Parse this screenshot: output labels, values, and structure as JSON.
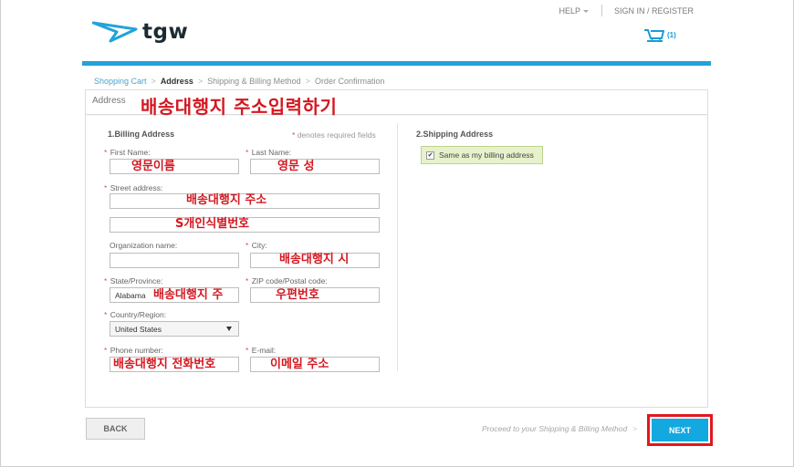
{
  "header": {
    "logo_text": "tgw",
    "help_label": "HELP",
    "signin_label": "SIGN IN / REGISTER",
    "cart_count": "(1)",
    "accent_color": "#22a3d9"
  },
  "breadcrumb": {
    "steps": [
      "Shopping Cart",
      "Address",
      "Shipping & Billing Method",
      "Order Confirmation"
    ],
    "separator": ">"
  },
  "panel": {
    "title": "Address",
    "annotation": "배송대행지 주소입력하기"
  },
  "billing": {
    "title": "1.Billing Address",
    "required_note": "denotes required fields",
    "required_star": "*",
    "first_name": {
      "label": "First Name:",
      "annotation": "영문이름"
    },
    "last_name": {
      "label": "Last Name:",
      "annotation": "영문 성"
    },
    "street": {
      "label": "Street address:",
      "annotation_line1": "배송대행지 주소",
      "annotation_line2": "S개인식별번호"
    },
    "organization": {
      "label": "Organization name:"
    },
    "city": {
      "label": "City:",
      "annotation": "배송대행지 시"
    },
    "state": {
      "label": "State/Province:",
      "value": "Alabama",
      "annotation": "배송대행지 주"
    },
    "zip": {
      "label": "ZIP code/Postal code:",
      "annotation": "우편번호"
    },
    "country": {
      "label": "Country/Region:",
      "value": "United States"
    },
    "phone": {
      "label": "Phone number:",
      "annotation": "배송대행지 전화번호"
    },
    "email": {
      "label": "E-mail:",
      "annotation": "이메일 주소"
    }
  },
  "shipping": {
    "title": "2.Shipping Address",
    "same_as_billing_label": "Same as my billing address",
    "same_as_billing_checked": true
  },
  "footer": {
    "back_label": "BACK",
    "proceed_text": "Proceed to your Shipping & Billing Method",
    "next_label": "NEXT",
    "highlight_color": "#e1171f"
  }
}
